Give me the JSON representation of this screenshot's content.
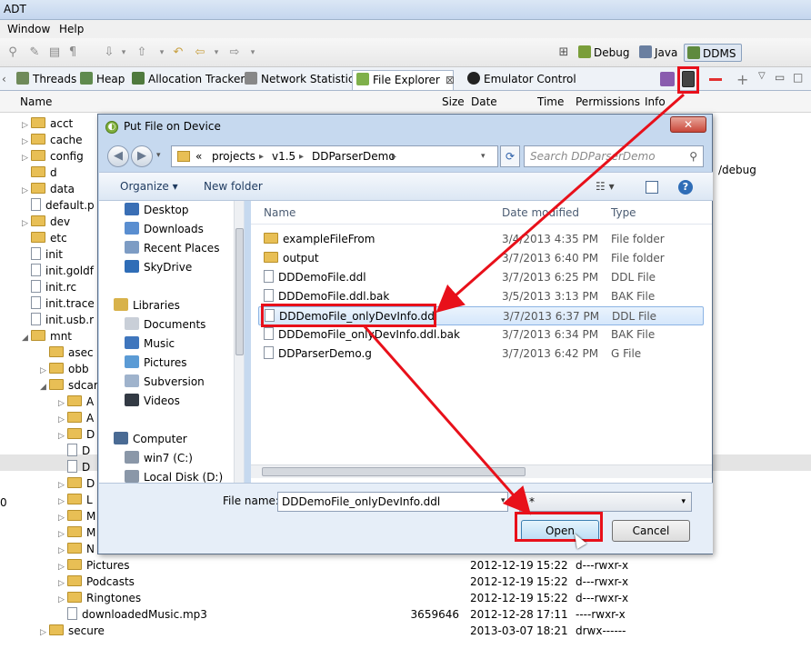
{
  "window": {
    "title": "ADT"
  },
  "menubar": [
    "Window",
    "Help"
  ],
  "perspectives": [
    {
      "label": "Debug",
      "icon": "debug-icon"
    },
    {
      "label": "Java",
      "icon": "java-icon"
    },
    {
      "label": "DDMS",
      "icon": "ddms-icon"
    }
  ],
  "tabs": [
    {
      "label": "Threads"
    },
    {
      "label": "Heap"
    },
    {
      "label": "Allocation Tracker"
    },
    {
      "label": "Network Statistics"
    },
    {
      "label": "File Explorer",
      "close": "⊠"
    },
    {
      "label": "Emulator Control"
    }
  ],
  "file_explorer": {
    "columns": [
      "Name",
      "Size",
      "Date",
      "Time",
      "Permissions",
      "Info"
    ],
    "items": [
      {
        "name": "acct",
        "type": "folder",
        "expand": "▷"
      },
      {
        "name": "cache",
        "type": "folder",
        "expand": "▷"
      },
      {
        "name": "config",
        "type": "folder",
        "expand": "▷"
      },
      {
        "name": "d",
        "type": "folder",
        "expand": ""
      },
      {
        "name": "data",
        "type": "folder",
        "expand": "▷"
      },
      {
        "name": "default.p",
        "type": "file",
        "expand": ""
      },
      {
        "name": "dev",
        "type": "folder",
        "expand": "▷"
      },
      {
        "name": "etc",
        "type": "folder",
        "expand": ""
      },
      {
        "name": "init",
        "type": "file",
        "expand": ""
      },
      {
        "name": "init.goldf",
        "type": "file",
        "expand": ""
      },
      {
        "name": "init.rc",
        "type": "file",
        "expand": ""
      },
      {
        "name": "init.trace",
        "type": "file",
        "expand": ""
      },
      {
        "name": "init.usb.r",
        "type": "file",
        "expand": ""
      },
      {
        "name": "mnt",
        "type": "folder",
        "expand": "◢"
      },
      {
        "name": "asec",
        "type": "folder",
        "expand": ""
      },
      {
        "name": "obb",
        "type": "folder",
        "expand": "▷"
      },
      {
        "name": "sdcar",
        "type": "folder",
        "expand": "◢"
      },
      {
        "name": "A",
        "type": "folder",
        "expand": "▷"
      },
      {
        "name": "A",
        "type": "folder",
        "expand": "▷"
      },
      {
        "name": "D",
        "type": "folder",
        "expand": "▷"
      },
      {
        "name": "D",
        "type": "file",
        "expand": ""
      },
      {
        "name": "D",
        "type": "file",
        "expand": ""
      },
      {
        "name": "D",
        "type": "folder",
        "expand": "▷"
      },
      {
        "name": "L",
        "type": "folder",
        "expand": "▷"
      },
      {
        "name": "M",
        "type": "folder",
        "expand": "▷"
      },
      {
        "name": "M",
        "type": "folder",
        "expand": "▷"
      },
      {
        "name": "N",
        "type": "folder",
        "expand": "▷"
      },
      {
        "name": "Pictures",
        "type": "folder",
        "expand": "▷",
        "size": "",
        "date": "2012-12-19",
        "time": "15:22",
        "perm": "d---rwxr-x"
      },
      {
        "name": "Podcasts",
        "type": "folder",
        "expand": "▷",
        "size": "",
        "date": "2012-12-19",
        "time": "15:22",
        "perm": "d---rwxr-x"
      },
      {
        "name": "Ringtones",
        "type": "folder",
        "expand": "▷",
        "size": "",
        "date": "2012-12-19",
        "time": "15:22",
        "perm": "d---rwxr-x"
      },
      {
        "name": "downloadedMusic.mp3",
        "type": "file",
        "expand": "",
        "size": "3659646",
        "date": "2012-12-28",
        "time": "17:11",
        "perm": "----rwxr-x"
      },
      {
        "name": "secure",
        "type": "folder",
        "expand": "▷",
        "size": "",
        "date": "2013-03-07",
        "time": "18:21",
        "perm": "drwx------"
      }
    ],
    "partial_info": "/debug"
  },
  "dialog": {
    "title": "Put File on Device",
    "close_label": "✕",
    "breadcrumb": [
      "«",
      "projects",
      "v1.5",
      "DDParserDemo"
    ],
    "search_placeholder": "Search DDParserDemo",
    "organize_label": "Organize ▾",
    "new_folder_label": "New folder",
    "nav_items": [
      {
        "label": "Desktop",
        "icon": "desktop-icon",
        "color": "#3a6fb5"
      },
      {
        "label": "Downloads",
        "icon": "downloads-icon",
        "color": "#5a8ed0"
      },
      {
        "label": "Recent Places",
        "icon": "recent-places-icon",
        "color": "#7d9cc4"
      },
      {
        "label": "SkyDrive",
        "icon": "skydrive-icon",
        "color": "#2f6db7"
      },
      {
        "label": "Libraries",
        "icon": "libraries-icon",
        "color": "#d8b24a"
      },
      {
        "label": "Documents",
        "icon": "documents-icon",
        "color": "#c9cfd8"
      },
      {
        "label": "Music",
        "icon": "music-icon",
        "color": "#3f76bd"
      },
      {
        "label": "Pictures",
        "icon": "pictures-icon",
        "color": "#5b9bd5"
      },
      {
        "label": "Subversion",
        "icon": "subversion-icon",
        "color": "#9fb3cc"
      },
      {
        "label": "Videos",
        "icon": "videos-icon",
        "color": "#333a44"
      },
      {
        "label": "Computer",
        "icon": "computer-icon",
        "color": "#4a6b94"
      },
      {
        "label": "win7 (C:)",
        "icon": "drive-icon",
        "color": "#8a97a8"
      },
      {
        "label": "Local Disk (D:)",
        "icon": "drive-icon",
        "color": "#8a97a8"
      }
    ],
    "file_columns": [
      "Name",
      "Date modified",
      "Type"
    ],
    "files": [
      {
        "name": "exampleFileFrom",
        "date": "3/4/2013 4:35 PM",
        "type": "File folder",
        "kind": "folder"
      },
      {
        "name": "output",
        "date": "3/7/2013 6:40 PM",
        "type": "File folder",
        "kind": "folder"
      },
      {
        "name": "DDDemoFile.ddl",
        "date": "3/7/2013 6:25 PM",
        "type": "DDL File",
        "kind": "file"
      },
      {
        "name": "DDDemoFile.ddl.bak",
        "date": "3/5/2013 3:13 PM",
        "type": "BAK File",
        "kind": "file"
      },
      {
        "name": "DDDemoFile_onlyDevInfo.ddl",
        "date": "3/7/2013 6:37 PM",
        "type": "DDL File",
        "kind": "file",
        "selected": true
      },
      {
        "name": "DDDemoFile_onlyDevInfo.ddl.bak",
        "date": "3/7/2013 6:34 PM",
        "type": "BAK File",
        "kind": "file"
      },
      {
        "name": "DDParserDemo.g",
        "date": "3/7/2013 6:42 PM",
        "type": "G File",
        "kind": "file"
      }
    ],
    "filename_label": "File name:",
    "filename_value": "DDDemoFile_onlyDevInfo.ddl",
    "filetype_value": "*",
    "open_label": "Open",
    "cancel_label": "Cancel"
  },
  "annotation_color": "#e8101a"
}
